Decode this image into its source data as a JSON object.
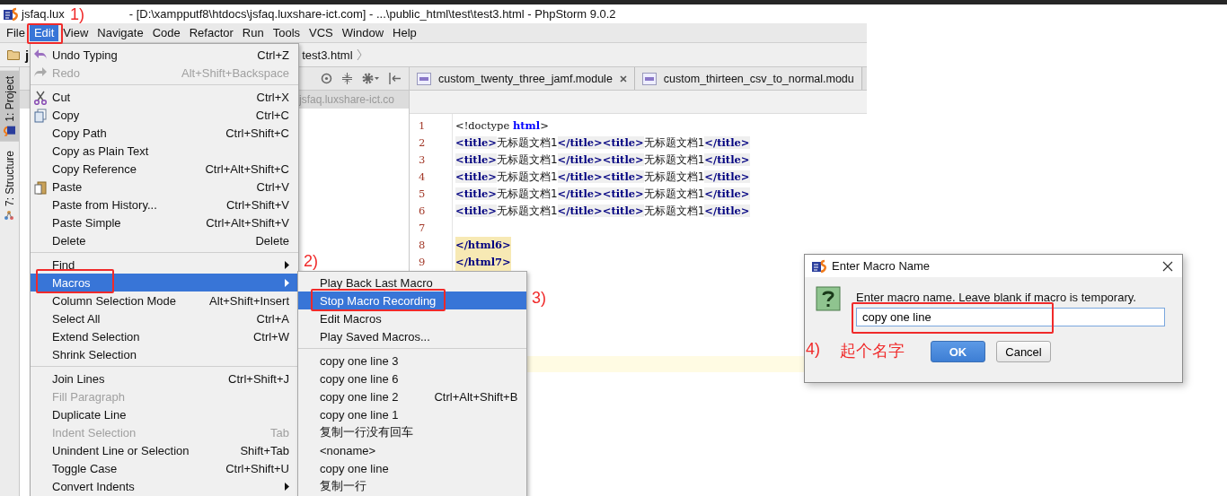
{
  "title_bar": {
    "project": "jsfaq.lux",
    "path": "- [D:\\xampputf8\\htdocs\\jsfaq.luxshare-ict.com] - ...\\public_html\\test\\test3.html - PhpStorm 9.0.2"
  },
  "menu_bar": [
    {
      "label": "File",
      "selected": false
    },
    {
      "label": "Edit",
      "selected": true
    },
    {
      "label": "View",
      "selected": false
    },
    {
      "label": "Navigate",
      "selected": false
    },
    {
      "label": "Code",
      "selected": false
    },
    {
      "label": "Refactor",
      "selected": false
    },
    {
      "label": "Run",
      "selected": false
    },
    {
      "label": "Tools",
      "selected": false
    },
    {
      "label": "VCS",
      "selected": false
    },
    {
      "label": "Window",
      "selected": false
    },
    {
      "label": "Help",
      "selected": false
    }
  ],
  "nav_bar": {
    "project": "j",
    "file": "test3.html"
  },
  "tool_strip": [
    {
      "label": "1: Project",
      "selected": true
    },
    {
      "label": "7: Structure",
      "selected": false
    }
  ],
  "project_panel": {
    "root": "jsfaq.luxshare-ict.co"
  },
  "editor_tabs": [
    {
      "label": "custom_twenty_three_jamf.module",
      "closable": true
    },
    {
      "label": "custom_thirteen_csv_to_normal.modu",
      "closable": false
    }
  ],
  "editor": {
    "lines": [
      {
        "number": "1",
        "highlighted": false,
        "segments": [
          {
            "kind": "plain",
            "text": "<!doctype "
          },
          {
            "kind": "keyword",
            "text": "html"
          },
          {
            "kind": "plain",
            "text": ">"
          }
        ]
      },
      {
        "number": "2",
        "highlighted": false,
        "segments": [
          {
            "kind": "tag",
            "text": "<title>"
          },
          {
            "kind": "text",
            "text": "无标题文档1"
          },
          {
            "kind": "tag",
            "text": "</title>"
          },
          {
            "kind": "tag",
            "text": "<title>"
          },
          {
            "kind": "text",
            "text": "无标题文档1"
          },
          {
            "kind": "tag",
            "text": "</title>"
          }
        ]
      },
      {
        "number": "3",
        "highlighted": false,
        "segments": [
          {
            "kind": "tag",
            "text": "<title>"
          },
          {
            "kind": "text",
            "text": "无标题文档1"
          },
          {
            "kind": "tag",
            "text": "</title>"
          },
          {
            "kind": "tag",
            "text": "<title>"
          },
          {
            "kind": "text",
            "text": "无标题文档1"
          },
          {
            "kind": "tag",
            "text": "</title>"
          }
        ]
      },
      {
        "number": "4",
        "highlighted": false,
        "segments": [
          {
            "kind": "tag",
            "text": "<title>"
          },
          {
            "kind": "text",
            "text": "无标题文档1"
          },
          {
            "kind": "tag",
            "text": "</title>"
          },
          {
            "kind": "tag",
            "text": "<title>"
          },
          {
            "kind": "text",
            "text": "无标题文档1"
          },
          {
            "kind": "tag",
            "text": "</title>"
          }
        ]
      },
      {
        "number": "5",
        "highlighted": false,
        "segments": [
          {
            "kind": "tag",
            "text": "<title>"
          },
          {
            "kind": "text",
            "text": "无标题文档1"
          },
          {
            "kind": "tag",
            "text": "</title>"
          },
          {
            "kind": "tag",
            "text": "<title>"
          },
          {
            "kind": "text",
            "text": "无标题文档1"
          },
          {
            "kind": "tag",
            "text": "</title>"
          }
        ]
      },
      {
        "number": "6",
        "highlighted": false,
        "segments": [
          {
            "kind": "tag",
            "text": "<title>"
          },
          {
            "kind": "text",
            "text": "无标题文档1"
          },
          {
            "kind": "tag",
            "text": "</title>"
          },
          {
            "kind": "tag",
            "text": "<title>"
          },
          {
            "kind": "text",
            "text": "无标题文档1"
          },
          {
            "kind": "tag",
            "text": "</title>"
          }
        ]
      },
      {
        "number": "7"
      },
      {
        "number": "8",
        "highlighted": true,
        "segments": [
          {
            "kind": "tag",
            "text": "</html6>"
          }
        ]
      },
      {
        "number": "9",
        "highlighted": true,
        "segments": [
          {
            "kind": "tag",
            "text": "</html7>"
          }
        ]
      }
    ]
  },
  "edit_menu": [
    {
      "kind": "item",
      "label": "Undo Typing",
      "shortcut": "Ctrl+Z",
      "disabled": false,
      "selected": false,
      "submenu": false
    },
    {
      "kind": "item",
      "label": "Redo",
      "shortcut": "Alt+Shift+Backspace",
      "disabled": true,
      "selected": false,
      "submenu": false
    },
    {
      "kind": "separator"
    },
    {
      "kind": "item",
      "label": "Cut",
      "shortcut": "Ctrl+X",
      "disabled": false,
      "selected": false,
      "submenu": false
    },
    {
      "kind": "item",
      "label": "Copy",
      "shortcut": "Ctrl+C",
      "disabled": false,
      "selected": false,
      "submenu": false
    },
    {
      "kind": "item",
      "label": "Copy Path",
      "shortcut": "Ctrl+Shift+C",
      "disabled": false,
      "selected": false,
      "submenu": false
    },
    {
      "kind": "item",
      "label": "Copy as Plain Text",
      "disabled": false,
      "selected": false,
      "submenu": false
    },
    {
      "kind": "item",
      "label": "Copy Reference",
      "shortcut": "Ctrl+Alt+Shift+C",
      "disabled": false,
      "selected": false,
      "submenu": false
    },
    {
      "kind": "item",
      "label": "Paste",
      "shortcut": "Ctrl+V",
      "disabled": false,
      "selected": false,
      "submenu": false
    },
    {
      "kind": "item",
      "label": "Paste from History...",
      "shortcut": "Ctrl+Shift+V",
      "disabled": false,
      "selected": false,
      "submenu": false
    },
    {
      "kind": "item",
      "label": "Paste Simple",
      "shortcut": "Ctrl+Alt+Shift+V",
      "disabled": false,
      "selected": false,
      "submenu": false
    },
    {
      "kind": "item",
      "label": "Delete",
      "shortcut": "Delete",
      "disabled": false,
      "selected": false,
      "submenu": false
    },
    {
      "kind": "separator"
    },
    {
      "kind": "item",
      "label": "Find",
      "disabled": false,
      "selected": false,
      "submenu": true
    },
    {
      "kind": "item",
      "label": "Macros",
      "disabled": false,
      "selected": true,
      "submenu": true
    },
    {
      "kind": "item",
      "label": "Column Selection Mode",
      "shortcut": "Alt+Shift+Insert",
      "disabled": false,
      "selected": false,
      "submenu": false
    },
    {
      "kind": "item",
      "label": "Select All",
      "shortcut": "Ctrl+A",
      "disabled": false,
      "selected": false,
      "submenu": false
    },
    {
      "kind": "item",
      "label": "Extend Selection",
      "shortcut": "Ctrl+W",
      "disabled": false,
      "selected": false,
      "submenu": false
    },
    {
      "kind": "item",
      "label": "Shrink Selection",
      "disabled": false,
      "selected": false,
      "submenu": false
    },
    {
      "kind": "separator"
    },
    {
      "kind": "item",
      "label": "Join Lines",
      "shortcut": "Ctrl+Shift+J",
      "disabled": false,
      "selected": false,
      "submenu": false
    },
    {
      "kind": "item",
      "label": "Fill Paragraph",
      "disabled": true,
      "selected": false,
      "submenu": false
    },
    {
      "kind": "item",
      "label": "Duplicate Line",
      "disabled": false,
      "selected": false,
      "submenu": false
    },
    {
      "kind": "item",
      "label": "Indent Selection",
      "shortcut": "Tab",
      "disabled": true,
      "selected": false,
      "submenu": false
    },
    {
      "kind": "item",
      "label": "Unindent Line or Selection",
      "shortcut": "Shift+Tab",
      "disabled": false,
      "selected": false,
      "submenu": false
    },
    {
      "kind": "item",
      "label": "Toggle Case",
      "shortcut": "Ctrl+Shift+U",
      "disabled": false,
      "selected": false,
      "submenu": false
    },
    {
      "kind": "item",
      "label": "Convert Indents",
      "disabled": false,
      "selected": false,
      "submenu": true
    }
  ],
  "macros_menu": [
    {
      "kind": "item",
      "label": "Play Back Last Macro",
      "selected": false
    },
    {
      "kind": "item",
      "label": "Stop Macro Recording",
      "selected": true
    },
    {
      "kind": "item",
      "label": "Edit Macros",
      "selected": false
    },
    {
      "kind": "item",
      "label": "Play Saved Macros...",
      "selected": false
    },
    {
      "kind": "separator"
    },
    {
      "kind": "item",
      "label": "copy one line 3",
      "selected": false
    },
    {
      "kind": "item",
      "label": "copy one line 6",
      "selected": false
    },
    {
      "kind": "item",
      "label": "copy one line 2",
      "shortcut": "Ctrl+Alt+Shift+B",
      "selected": false
    },
    {
      "kind": "item",
      "label": "copy one line 1",
      "selected": false
    },
    {
      "kind": "item",
      "label": "复制一行没有回车",
      "selected": false
    },
    {
      "kind": "item",
      "label": "<noname>",
      "selected": false
    },
    {
      "kind": "item",
      "label": "copy one line",
      "selected": false
    },
    {
      "kind": "item",
      "label": "复制一行",
      "selected": false
    }
  ],
  "dialog": {
    "title": "Enter Macro Name",
    "message": "Enter macro name. Leave blank if macro is temporary.",
    "value": "copy one line",
    "buttons": [
      {
        "label": "OK",
        "default": true
      },
      {
        "label": "Cancel",
        "default": false
      }
    ]
  },
  "annotations": [
    {
      "label": "1)"
    },
    {
      "label": "2)"
    },
    {
      "label": "3)"
    },
    {
      "label": "4)",
      "note": "起个名字"
    }
  ]
}
